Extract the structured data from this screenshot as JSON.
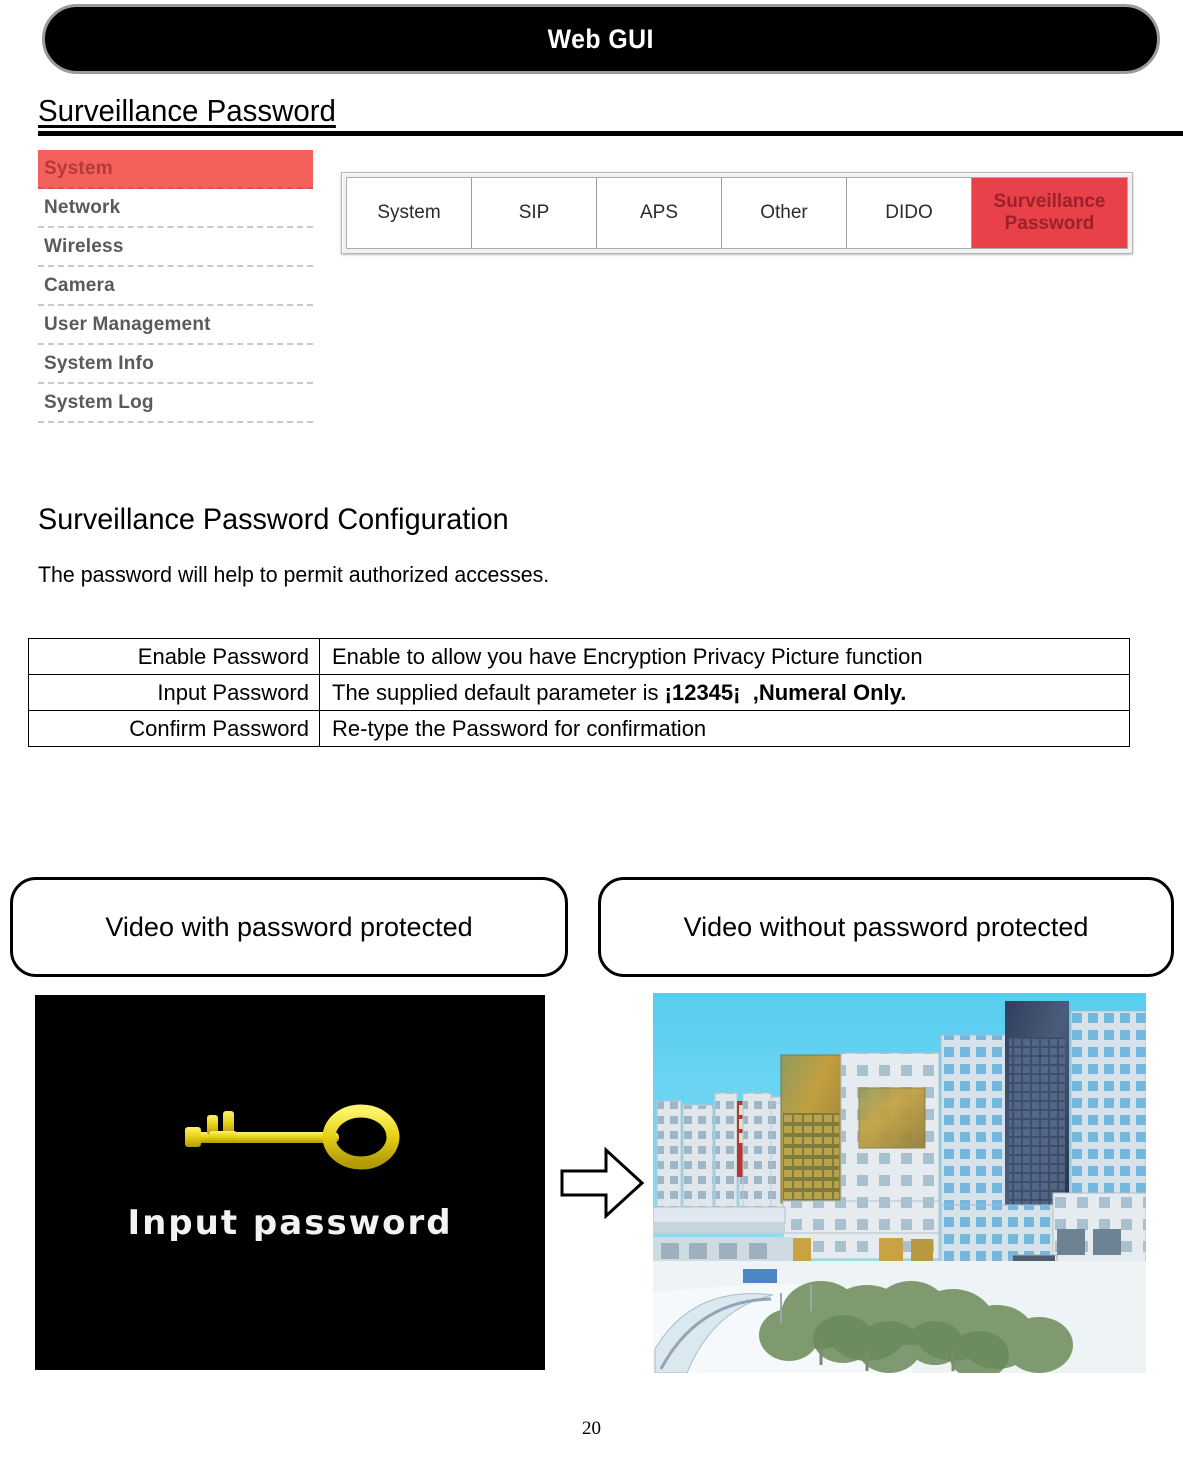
{
  "header": {
    "title": "Web GUI"
  },
  "section": {
    "heading": "Surveillance Password"
  },
  "sidebar": {
    "items": [
      {
        "label": "System",
        "active": true
      },
      {
        "label": "Network",
        "active": false
      },
      {
        "label": "Wireless",
        "active": false
      },
      {
        "label": "Camera",
        "active": false
      },
      {
        "label": "User Management",
        "active": false
      },
      {
        "label": "System Info",
        "active": false
      },
      {
        "label": "System Log",
        "active": false
      }
    ],
    "active_color": "#f4615c"
  },
  "tabs": {
    "items": [
      {
        "label": "System",
        "active": false
      },
      {
        "label": "SIP",
        "active": false
      },
      {
        "label": "APS",
        "active": false
      },
      {
        "label": "Other",
        "active": false
      },
      {
        "label": "DIDO",
        "active": false
      },
      {
        "label": "Surveillance Password",
        "active": true
      }
    ],
    "active_color": "#e8414a"
  },
  "config": {
    "title": "Surveillance Password Configuration",
    "subtitle": "The password will help to permit authorized accesses."
  },
  "param_table": {
    "rows": [
      {
        "label": "Enable Password",
        "desc_plain": "Enable to allow you have Encryption Privacy Picture function",
        "desc_prefix": "Enable to allow you have Encryption Privacy Picture function",
        "desc_bold": "",
        "desc_suffix": ""
      },
      {
        "label": "Input Password",
        "desc_plain": "The supplied default parameter is ¡12345¡ ,Numeral Only.",
        "desc_prefix": "The supplied default parameter is ",
        "desc_bold": "¡12345¡",
        "desc_suffix": ",Numeral Only."
      },
      {
        "label": "Confirm Password",
        "desc_plain": "Re-type the Password for confirmation",
        "desc_prefix": "Re-type the Password for confirmation",
        "desc_bold": "",
        "desc_suffix": ""
      }
    ]
  },
  "captions": {
    "left": "Video with password protected",
    "right": "Video without password protected"
  },
  "videos": {
    "left": {
      "overlay_text": "Input password",
      "background": "#000000",
      "icon": "key-icon",
      "icon_color": "#e8d41a"
    },
    "right": {
      "description": "City plaza with modern office towers under blue sky",
      "sky_color": "#6fd4f2"
    }
  },
  "flow": {
    "arrow": "right-block-arrow"
  },
  "footer": {
    "page_number": "20"
  }
}
